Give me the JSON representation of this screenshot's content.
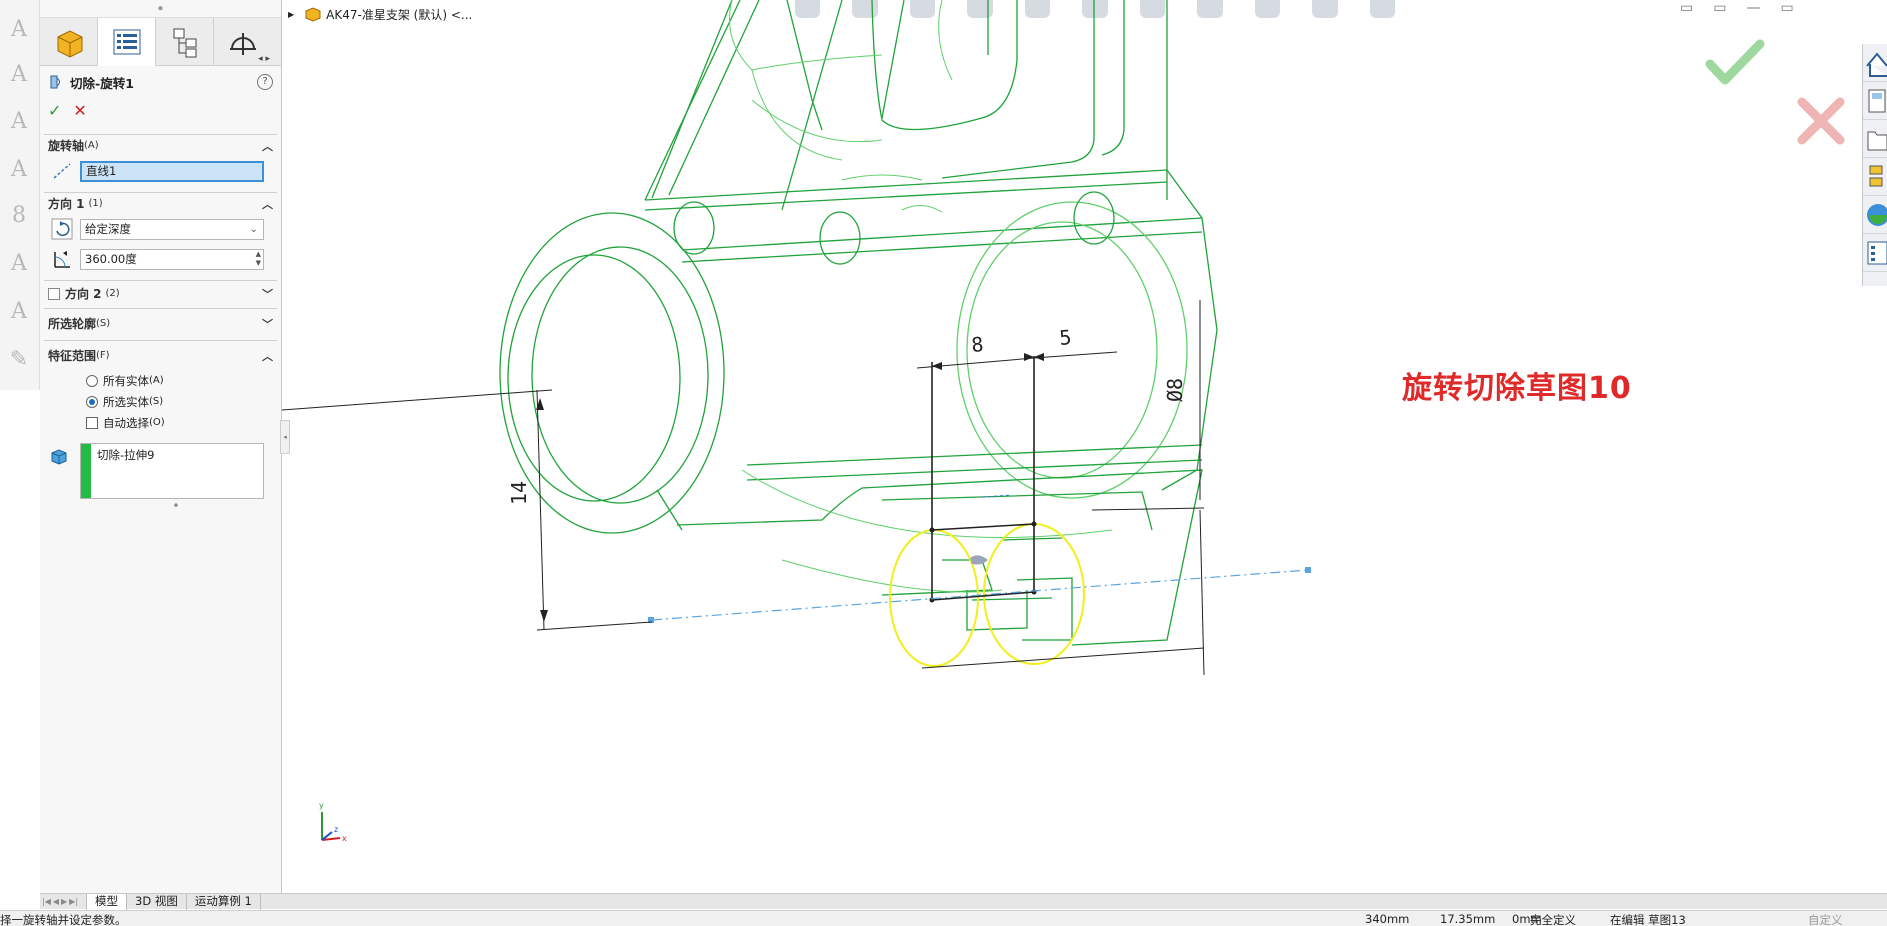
{
  "document": {
    "breadcrumb": "AK47-准星支架 (默认) <..."
  },
  "property_manager": {
    "title": "切除-旋转1",
    "help": "?",
    "ok_label": "✓",
    "cancel_label": "✕",
    "axis_group": {
      "title": "旋转轴",
      "suffix": "(A)",
      "value": "直线1"
    },
    "direction1_group": {
      "title": "方向 1",
      "suffix": "(1)",
      "end_condition": "给定深度",
      "angle": "360.00度"
    },
    "direction2_group": {
      "title": "方向 2",
      "suffix": "(2)"
    },
    "contours_group": {
      "title": "所选轮廓",
      "suffix": "(S)"
    },
    "scope_group": {
      "title": "特征范围",
      "suffix": "(F)",
      "options": [
        {
          "label": "所有实体",
          "suffix": "(A)",
          "selected": false
        },
        {
          "label": "所选实体",
          "suffix": "(S)",
          "selected": true
        }
      ],
      "auto_select": {
        "label": "自动选择",
        "suffix": "(O)",
        "checked": false
      },
      "bodies": [
        "切除-拉伸9"
      ]
    }
  },
  "sketch": {
    "dimensions": {
      "d1": "8",
      "d2": "5",
      "d3": "14",
      "d4": "Ø8"
    },
    "triad": {
      "x": "x",
      "y": "y",
      "z": "z"
    }
  },
  "annotation": "旋转切除草图10",
  "bottom_tabs": [
    "模型",
    "3D 视图",
    "运动算例 1"
  ],
  "status_bar": {
    "message": "择一旋转轴并设定参数。",
    "x": "340mm",
    "y": "17.35mm",
    "z": "0mm",
    "state": "完全定义",
    "editing": "在编辑 草图13",
    "units": "自定义"
  },
  "colors": {
    "model_edges": "#1fa33a",
    "model_edges_light": "#5fd06a",
    "selection_yellow": "#f1ef1a",
    "centerline": "#5aa4e0",
    "annotation": "#e02a2a"
  }
}
